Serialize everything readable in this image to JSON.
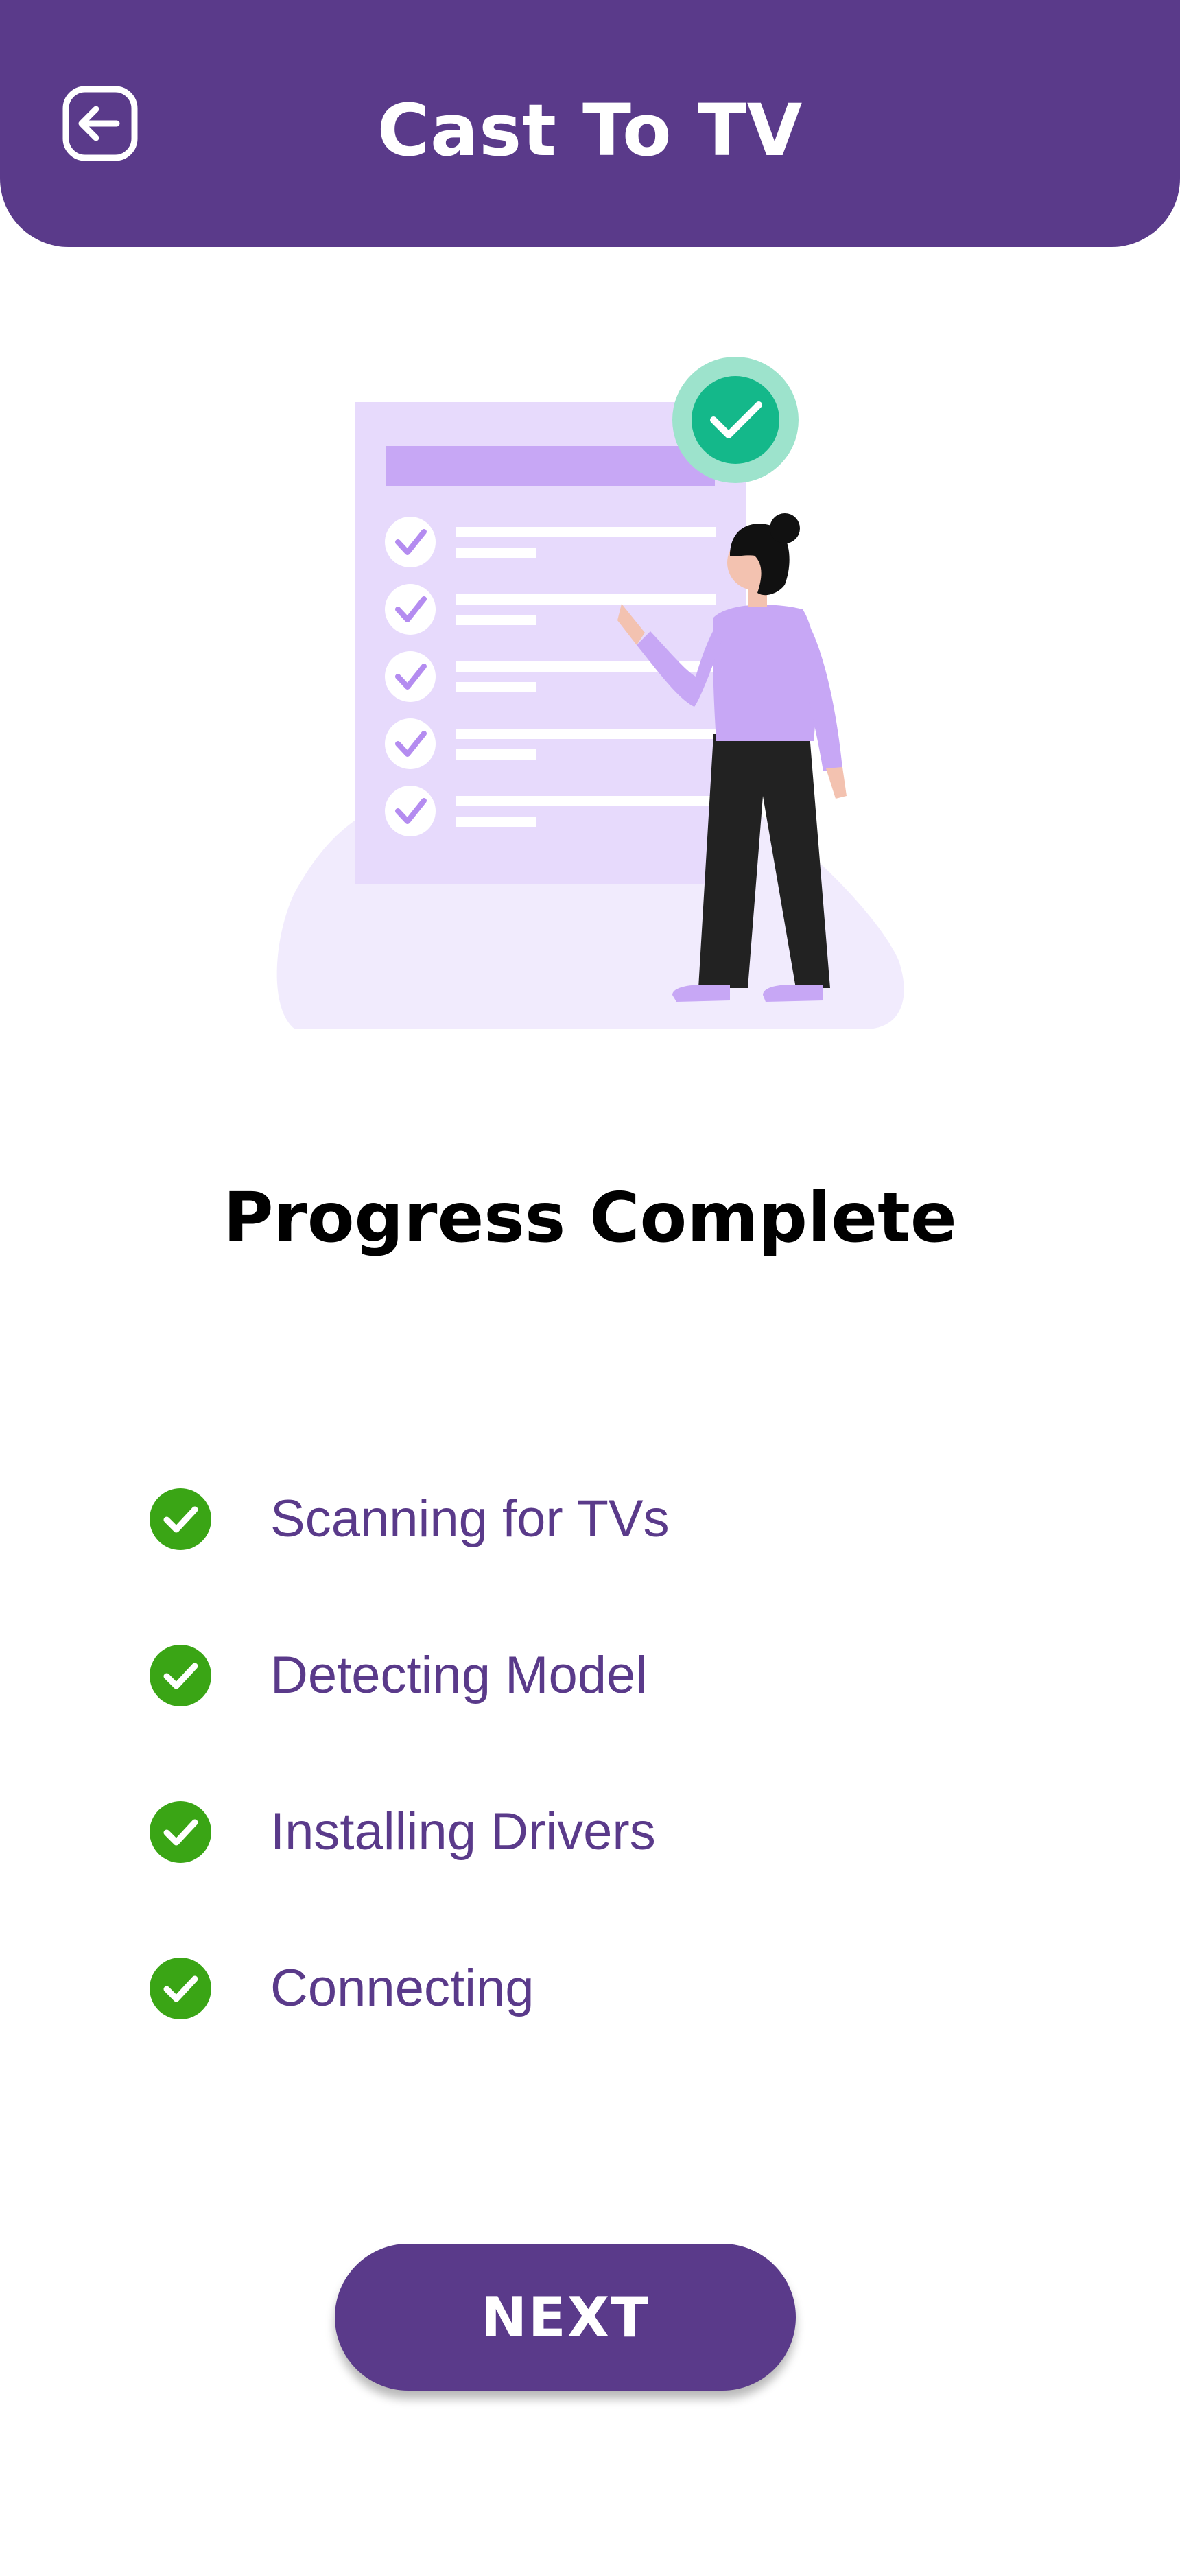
{
  "header": {
    "title": "Cast To TV",
    "back_icon": "back-arrow-icon",
    "background": "#5a3a8a"
  },
  "main": {
    "illustration": "checklist-woman-illustration",
    "title": "Progress Complete",
    "steps": [
      {
        "label": "Scanning for TVs",
        "icon": "check-circle-icon",
        "status": "complete"
      },
      {
        "label": "Detecting Model",
        "icon": "check-circle-icon",
        "status": "complete"
      },
      {
        "label": "Installing Drivers",
        "icon": "check-circle-icon",
        "status": "complete"
      },
      {
        "label": "Connecting",
        "icon": "check-circle-icon",
        "status": "complete"
      }
    ]
  },
  "footer": {
    "next_label": "NEXT"
  },
  "colors": {
    "brand": "#5a3a8a",
    "step_text": "#5a3a8a",
    "check_green": "#3aa515",
    "badge_green": "#14b88a"
  }
}
